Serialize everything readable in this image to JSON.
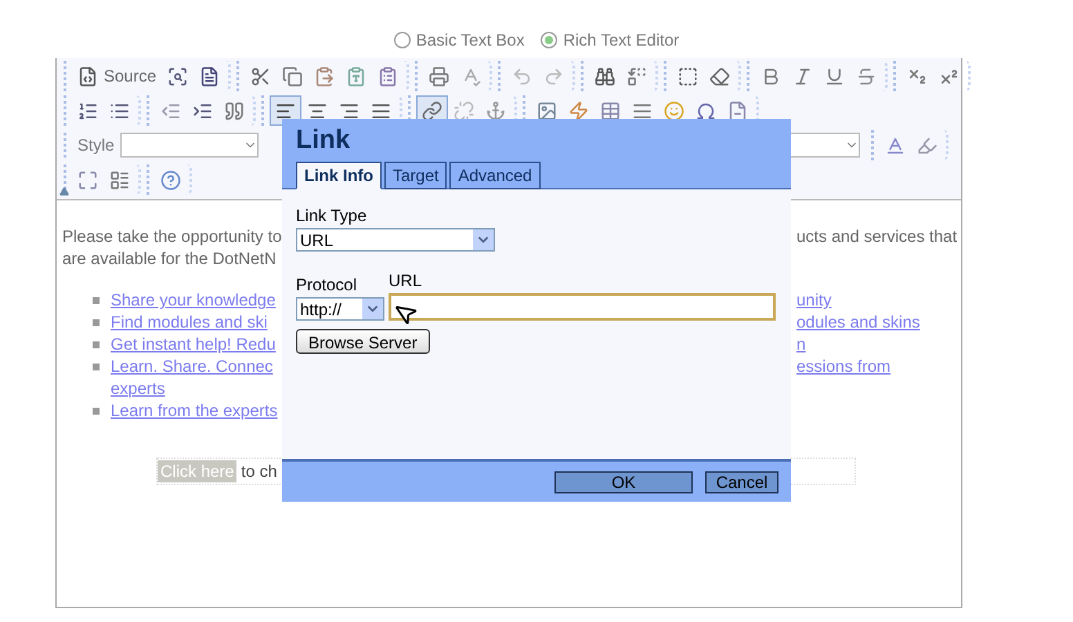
{
  "editor_mode": [
    {
      "label": "Basic Text Box",
      "selected": false
    },
    {
      "label": "Rich Text Editor",
      "selected": true
    }
  ],
  "toolbar": {
    "rows": [
      {
        "groups": [
          [
            {
              "kind": "source",
              "label": "Source",
              "selected": false
            },
            {
              "kind": "preview",
              "selected": false
            },
            {
              "kind": "templates",
              "selected": false
            }
          ],
          [
            {
              "kind": "cut",
              "selected": false
            },
            {
              "kind": "copy",
              "selected": false
            },
            {
              "kind": "paste",
              "selected": false
            },
            {
              "kind": "paste-text",
              "selected": false
            },
            {
              "kind": "paste-word",
              "selected": false
            }
          ],
          [
            {
              "kind": "print",
              "selected": false
            },
            {
              "kind": "spellcheck",
              "selected": false
            }
          ],
          [
            {
              "kind": "undo",
              "selected": false
            },
            {
              "kind": "redo",
              "selected": false
            }
          ],
          [
            {
              "kind": "find",
              "selected": false
            },
            {
              "kind": "replace",
              "selected": false
            }
          ],
          [
            {
              "kind": "select-all",
              "selected": false
            },
            {
              "kind": "remove-format",
              "selected": false
            }
          ],
          [
            {
              "kind": "bold",
              "selected": false
            },
            {
              "kind": "italic",
              "selected": false
            },
            {
              "kind": "underline",
              "selected": false
            },
            {
              "kind": "strike",
              "selected": false
            }
          ],
          [
            {
              "kind": "subscript",
              "selected": false
            },
            {
              "kind": "superscript",
              "selected": false
            }
          ]
        ]
      },
      {
        "groups": [
          [
            {
              "kind": "ordered-list",
              "selected": false
            },
            {
              "kind": "bullet-list",
              "selected": false
            }
          ],
          [
            {
              "kind": "outdent",
              "selected": false
            },
            {
              "kind": "indent",
              "selected": false
            },
            {
              "kind": "blockquote",
              "selected": false
            }
          ],
          [
            {
              "kind": "align-left",
              "selected": true
            },
            {
              "kind": "align-center",
              "selected": false
            },
            {
              "kind": "align-right",
              "selected": false
            },
            {
              "kind": "justify",
              "selected": false
            }
          ],
          [
            {
              "kind": "link",
              "selected": true
            },
            {
              "kind": "unlink",
              "selected": false
            },
            {
              "kind": "anchor",
              "selected": false
            }
          ],
          [
            {
              "kind": "image",
              "selected": false
            },
            {
              "kind": "flash",
              "selected": false
            },
            {
              "kind": "table",
              "selected": false
            },
            {
              "kind": "rule",
              "selected": false
            },
            {
              "kind": "smiley",
              "selected": false
            },
            {
              "kind": "special-char",
              "selected": false
            },
            {
              "kind": "page-break",
              "selected": false
            }
          ]
        ]
      },
      {
        "style_label": "Style",
        "groups": [
          [
            {
              "kind": "text-color",
              "selected": false
            },
            {
              "kind": "bg-color",
              "selected": false
            }
          ]
        ]
      },
      {
        "groups": [
          [
            {
              "kind": "maximize",
              "selected": false
            },
            {
              "kind": "show-blocks",
              "selected": false
            }
          ],
          [
            {
              "kind": "about",
              "selected": false
            }
          ]
        ]
      }
    ]
  },
  "content": {
    "paragraph": [
      {
        "left": "Please take the opportunity to",
        "right": "ucts and services that"
      },
      {
        "left": "are available for the DotNetN"
      }
    ],
    "links": [
      {
        "left": "Share your knowledge",
        "right": "unity"
      },
      {
        "left": "Find modules and ski",
        "right": "odules and skins"
      },
      {
        "left": "Get instant help! Redu",
        "right": "n"
      },
      {
        "left": "Learn. Share. Connec",
        "right": "essions from",
        "continuation": "experts"
      },
      {
        "left": "Learn from the experts"
      }
    ],
    "click_here": "Click here",
    "click_rest": "to ch"
  },
  "dialog": {
    "title": "Link",
    "tabs": [
      {
        "label": "Link Info",
        "selected": true
      },
      {
        "label": "Target",
        "selected": false
      },
      {
        "label": "Advanced",
        "selected": false
      }
    ],
    "link_type_label": "Link Type",
    "link_type": "URL",
    "protocol_label": "Protocol",
    "protocol": "http://",
    "url_label": "URL",
    "browse_button": "Browse Server",
    "buttons": [
      "OK",
      "Cancel"
    ]
  }
}
